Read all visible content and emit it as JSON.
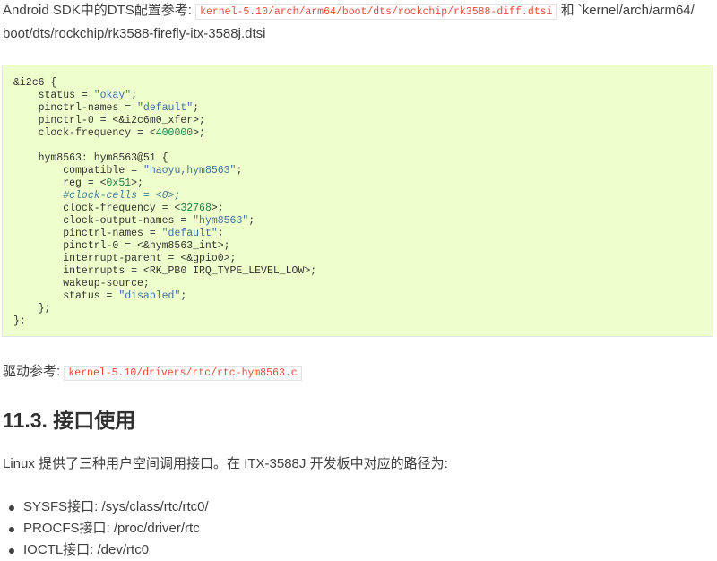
{
  "intro": {
    "text_before": "Android SDK中的DTS配置参考: ",
    "code_path_1": "kernel-5.10/arch/arm64/boot/dts/rockchip/rk3588-diff.dtsi",
    "text_middle": " 和 `kernel/arch/arm64/ boot/dts/rockchip/rk3588-firefly-itx-3588j.dtsi"
  },
  "code_block": {
    "lines": [
      "&i2c6 {",
      "    status = \"okay\";",
      "    pinctrl-names = \"default\";",
      "    pinctrl-0 = <&i2c6m0_xfer>;",
      "    clock-frequency = <400000>;",
      "",
      "    hym8563: hym8563@51 {",
      "        compatible = \"haoyu,hym8563\";",
      "        reg = <0x51>;",
      "        #clock-cells = <0>;",
      "        clock-frequency = <32768>;",
      "        clock-output-names = \"hym8563\";",
      "        pinctrl-names = \"default\";",
      "        pinctrl-0 = <&hym8563_int>;",
      "        interrupt-parent = <&gpio0>;",
      "        interrupts = <RK_PB0 IRQ_TYPE_LEVEL_LOW>;",
      "        wakeup-source;",
      "        status = \"disabled\";",
      "    };",
      "};"
    ]
  },
  "driver": {
    "label": "驱动参考: ",
    "code_path": "kernel-5.10/drivers/rtc/rtc-hym8563.c"
  },
  "section": {
    "heading": "11.3. 接口使用",
    "description": "Linux 提供了三种用户空间调用接口。在 ITX-3588J 开发板中对应的路径为:",
    "items": [
      "SYSFS接口: /sys/class/rtc/rtc0/",
      "PROCFS接口:  /proc/driver/rtc",
      "IOCTL接口:  /dev/rtc0"
    ]
  },
  "colors": {
    "code_block_bg": "#eeffcc",
    "inline_code_text": "#e74c3c",
    "string_token": "#4070a0",
    "number_token": "#208050",
    "comment_token": "#408090"
  }
}
